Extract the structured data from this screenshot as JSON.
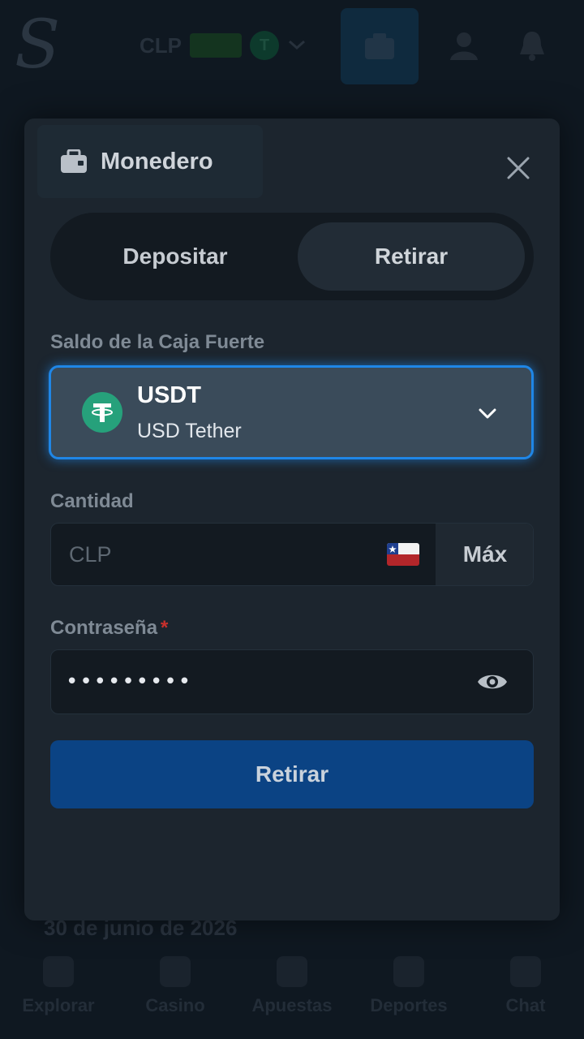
{
  "background": {
    "currency_code": "CLP",
    "date_text": "30 de junio de 2026",
    "nav": [
      {
        "label": "Explorar",
        "icon": "explore-icon"
      },
      {
        "label": "Casino",
        "icon": "casino-icon"
      },
      {
        "label": "Apuestas",
        "icon": "bets-icon"
      },
      {
        "label": "Deportes",
        "icon": "sports-icon"
      },
      {
        "label": "Chat",
        "icon": "chat-icon"
      }
    ]
  },
  "modal": {
    "title": "Monedero",
    "tabs": {
      "deposit": "Depositar",
      "withdraw": "Retirar",
      "active": "withdraw"
    },
    "vault_label": "Saldo de la Caja Fuerte",
    "coin": {
      "symbol": "USDT",
      "name": "USD Tether",
      "icon": "tether-icon",
      "color": "#26a17b"
    },
    "amount": {
      "label": "Cantidad",
      "placeholder": "CLP",
      "value": "",
      "flag": "chile-flag-icon",
      "max_label": "Máx"
    },
    "password": {
      "label": "Contraseña",
      "required_mark": "*",
      "value": "•••••••••"
    },
    "submit_label": "Retirar"
  },
  "colors": {
    "accent": "#1f86e6",
    "submit": "#0b4384",
    "modal_bg": "#1c252e"
  }
}
